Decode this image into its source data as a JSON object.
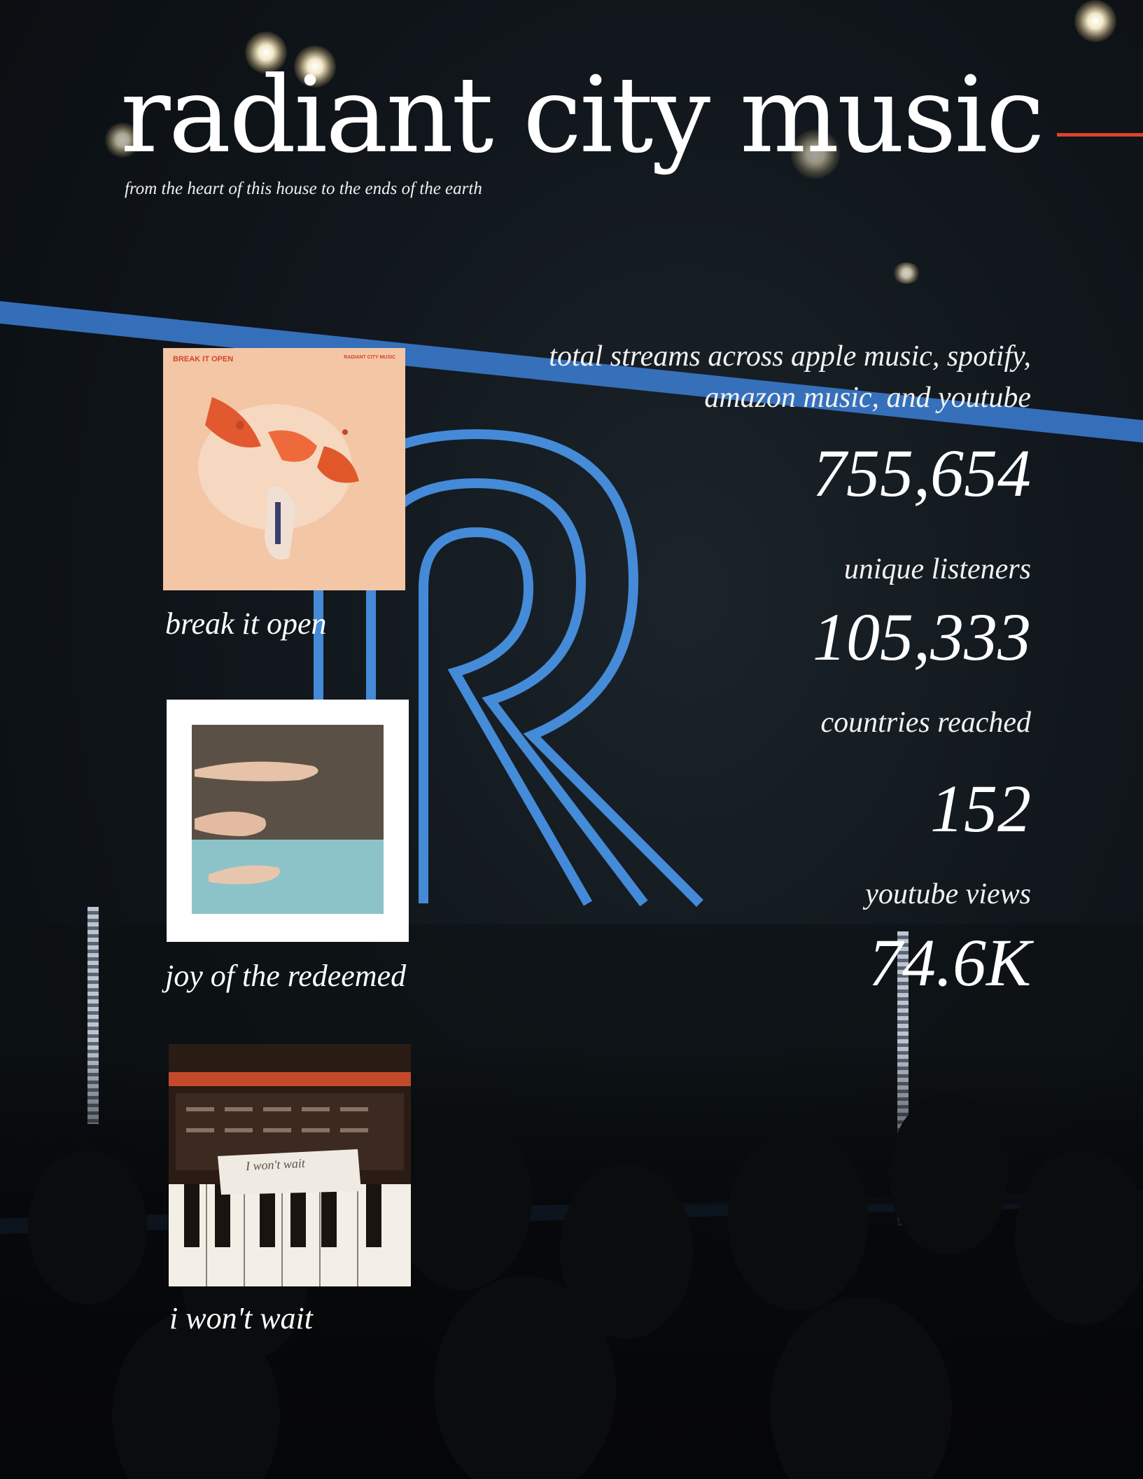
{
  "header": {
    "title": "radiant city music",
    "tagline": "from the heart of  this house to the ends of the earth"
  },
  "albums": [
    {
      "title": "break it open",
      "cover_text_left": "BREAK IT OPEN",
      "cover_text_right": "RADIANT CITY MUSIC"
    },
    {
      "title": "joy of the redeemed"
    },
    {
      "title": "i won't wait",
      "cover_note": "I won't wait"
    }
  ],
  "stats": [
    {
      "label": "total streams across apple music, spotify, amazon music, and youtube",
      "value": "755,654"
    },
    {
      "label": "unique listeners",
      "value": "105,333"
    },
    {
      "label": "countries reached",
      "value": "152"
    },
    {
      "label": "youtube views",
      "value": "74.6K"
    }
  ],
  "colors": {
    "accent": "#e0432b",
    "logo_blue": "#3c8ee8",
    "text": "#ffffff"
  }
}
